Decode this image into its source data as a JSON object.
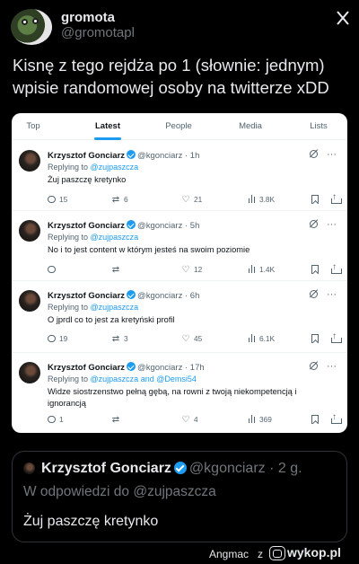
{
  "post": {
    "author_name": "gromota",
    "author_handle": "@gromotapl",
    "text": "Kisnę z tego rejdża po 1 (słownie: jednym) wpisie randomowej osoby na twitterze xDD"
  },
  "embed": {
    "tabs": [
      {
        "label": "Top"
      },
      {
        "label": "Latest"
      },
      {
        "label": "People"
      },
      {
        "label": "Media"
      },
      {
        "label": "Lists"
      }
    ],
    "active_tab": "Latest",
    "tweets": [
      {
        "name": "Krzysztof Gonciarz",
        "handle_time": "@kgonciarz · 1h",
        "replying_prefix": "Replying to ",
        "replying_to": "@zujpaszcza",
        "text": "Żuj paszczę kretynko",
        "replies": "15",
        "retweets": "6",
        "likes": "21",
        "views": "3.8K"
      },
      {
        "name": "Krzysztof Gonciarz",
        "handle_time": "@kgonciarz · 5h",
        "replying_prefix": "Replying to ",
        "replying_to": "@zujpaszcza",
        "text": "No i to jest content w którym jesteś na swoim poziomie",
        "replies": "",
        "retweets": "",
        "likes": "12",
        "views": "1.4K"
      },
      {
        "name": "Krzysztof Gonciarz",
        "handle_time": "@kgonciarz · 6h",
        "replying_prefix": "Replying to ",
        "replying_to": "@zujpaszcza",
        "text": "O jprdl co to jest za kretyński profil",
        "replies": "19",
        "retweets": "3",
        "likes": "45",
        "views": "6.1K"
      },
      {
        "name": "Krzysztof Gonciarz",
        "handle_time": "@kgonciarz · 17h",
        "replying_prefix": "Replying to ",
        "replying_to": "@zujpaszcza and @Demsi54",
        "text": "Widze siostrzenstwo pełną gębą, na rowni z twoją niekompetencją i ignorancją",
        "replies": "1",
        "retweets": "",
        "likes": "4",
        "views": "369"
      }
    ]
  },
  "quote": {
    "name": "Krzysztof Gonciarz",
    "handle_time": "@kgonciarz · 2 g.",
    "replying": "W odpowiedzi do @zujpaszcza",
    "text": "Żuj paszczę kretynko"
  },
  "footer": {
    "user": "Angmac",
    "separator": "z",
    "brand": "wykop.pl"
  },
  "colors": {
    "background": "#000000",
    "accent": "#1d9bf0",
    "verified": "#1d9bf0"
  },
  "icons": [
    "x-logo-icon",
    "verified-icon",
    "grok-icon",
    "more-icon",
    "reply-icon",
    "retweet-icon",
    "heart-icon",
    "views-icon",
    "bookmark-icon",
    "share-icon",
    "wykop-logo-icon"
  ]
}
